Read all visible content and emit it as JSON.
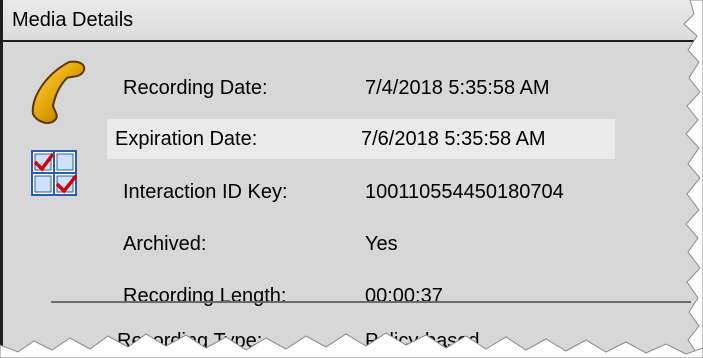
{
  "panel": {
    "title": "Media Details"
  },
  "icons": {
    "phone": "phone-handset-icon",
    "checks": "checklist-icon"
  },
  "details": [
    {
      "label": "Recording Date:",
      "value": "7/4/2018 5:35:58 AM"
    },
    {
      "label": "Expiration Date:",
      "value": "7/6/2018 5:35:58 AM"
    },
    {
      "label": "Interaction ID Key:",
      "value": "100110554450180704"
    },
    {
      "label": "Archived:",
      "value": "Yes"
    },
    {
      "label": "Recording Length:",
      "value": "00:00:37"
    }
  ],
  "partial_row": {
    "label": "Recording Type:",
    "value": "Policy-based"
  },
  "colors": {
    "panel_background": "#d7d7d7",
    "highlight_row": "#eaeaea",
    "phone_gold": "#e3a400",
    "check_red": "#d40000",
    "box_blue": "#2a5db0"
  }
}
